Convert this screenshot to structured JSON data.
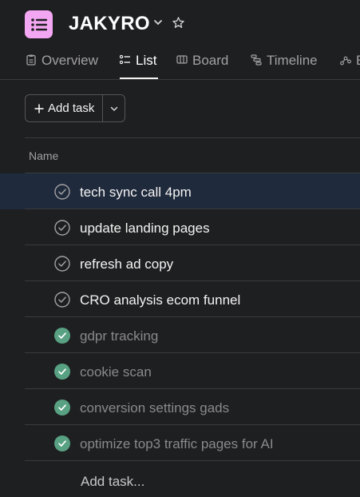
{
  "project": {
    "title": "JAKYRO",
    "icon": "list-icon",
    "icon_color": "#f3a6f1"
  },
  "tabs": [
    {
      "label": "Overview",
      "icon": "overview-icon"
    },
    {
      "label": "List",
      "icon": "list-icon",
      "active": true
    },
    {
      "label": "Board",
      "icon": "board-icon"
    },
    {
      "label": "Timeline",
      "icon": "timeline-icon"
    },
    {
      "label": "",
      "icon": "workflow-icon"
    }
  ],
  "toolbar": {
    "add_task_label": "Add task"
  },
  "table": {
    "name_header": "Name"
  },
  "tasks": [
    {
      "title": "tech sync call 4pm",
      "completed": false,
      "selected": true
    },
    {
      "title": "update landing pages",
      "completed": false
    },
    {
      "title": "refresh ad copy",
      "completed": false
    },
    {
      "title": "CRO analysis ecom funnel",
      "completed": false
    },
    {
      "title": "gdpr tracking",
      "completed": true
    },
    {
      "title": "cookie scan",
      "completed": true
    },
    {
      "title": "conversion settings gads",
      "completed": true
    },
    {
      "title": "optimize top3 traffic pages for AI",
      "completed": true
    }
  ],
  "add_task_row_label": "Add task...",
  "colors": {
    "background": "#1e1f21",
    "selected_row": "#1f2a3c",
    "complete_check": "#58a182",
    "divider": "#3a3b3d"
  }
}
